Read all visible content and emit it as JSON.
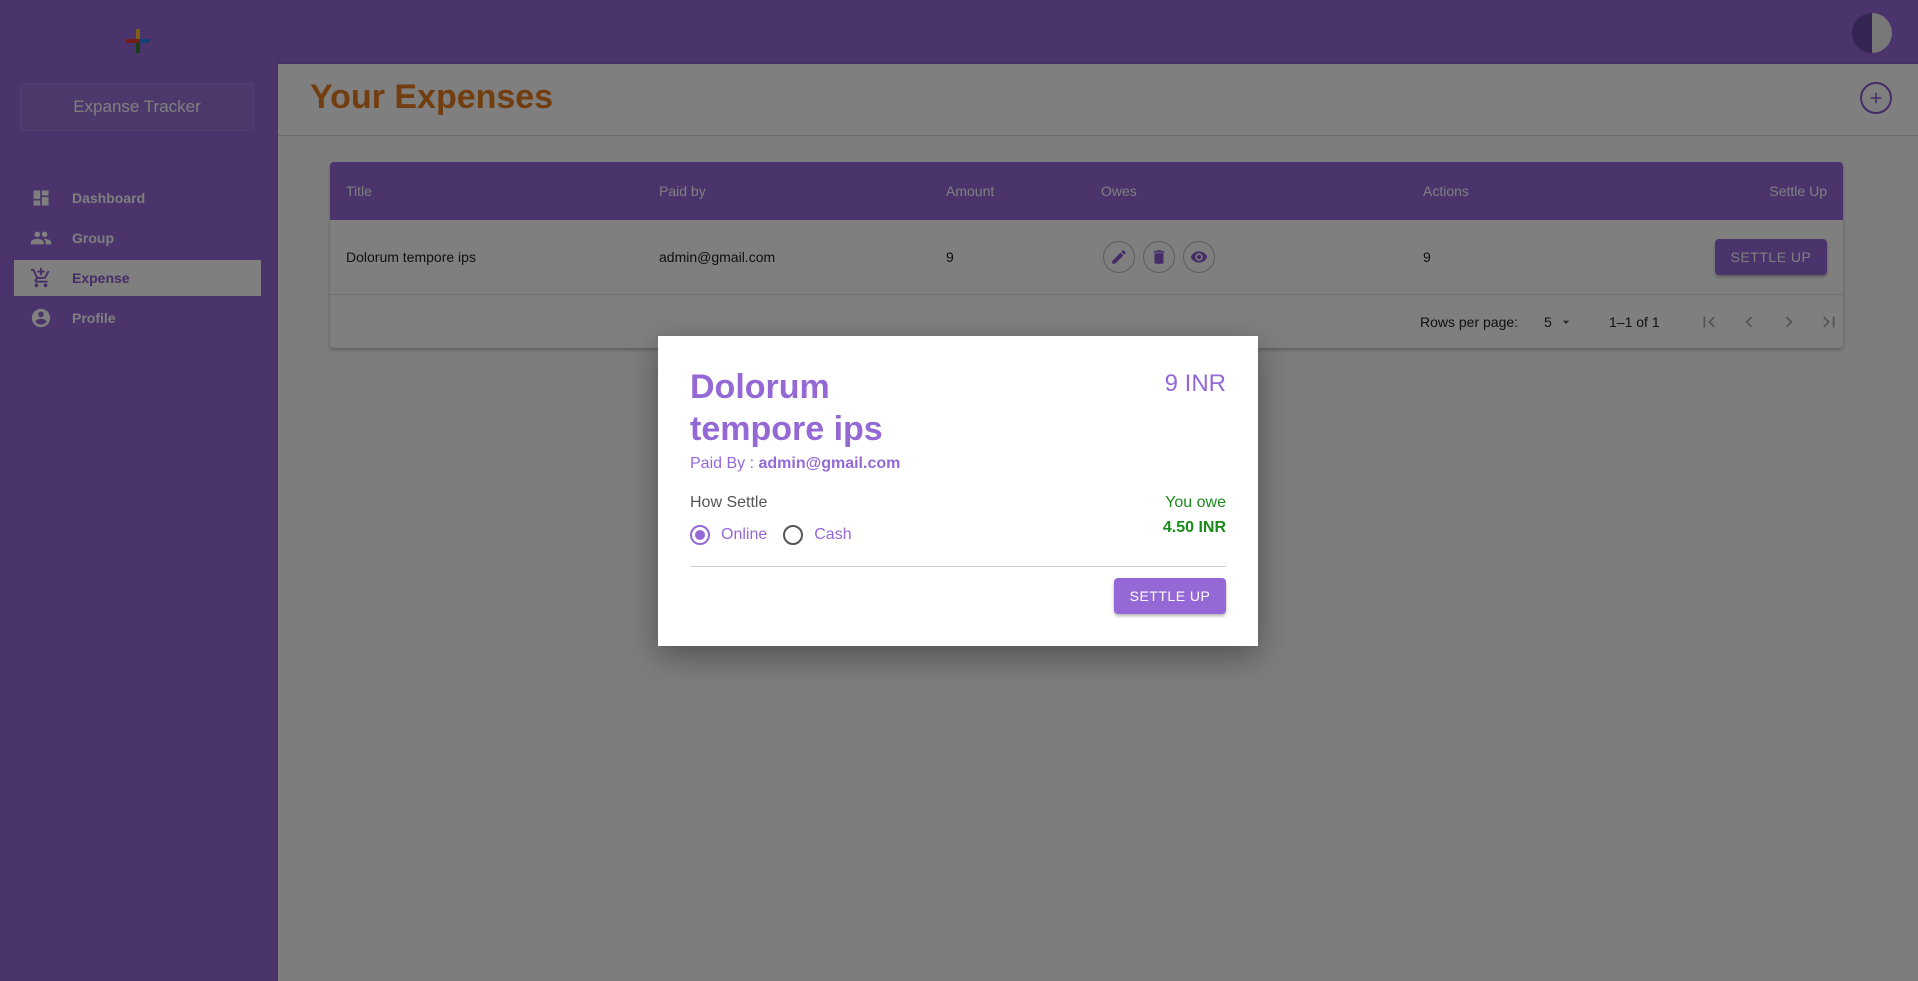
{
  "app": {
    "brand": "Expanse Tracker"
  },
  "sidebar": {
    "items": [
      {
        "label": "Dashboard",
        "icon": "dashboard-icon",
        "active": false
      },
      {
        "label": "Group",
        "icon": "group-icon",
        "active": false
      },
      {
        "label": "Expense",
        "icon": "cart-icon",
        "active": true
      },
      {
        "label": "Profile",
        "icon": "account-circle-icon",
        "active": false
      }
    ]
  },
  "header": {
    "page_title": "Your Expenses"
  },
  "table": {
    "columns": [
      "Title",
      "Paid by",
      "Amount",
      "Owes",
      "Actions",
      "Settle Up"
    ],
    "rows": [
      {
        "title": "Dolorum tempore ips",
        "paid_by": "admin@gmail.com",
        "amount": "9",
        "actions": "9",
        "settle_label": "SETTLE UP"
      }
    ],
    "pagination": {
      "rows_per_page_label": "Rows per page:",
      "rows_per_page": "5",
      "range": "1–1 of 1"
    }
  },
  "dialog": {
    "title": "Dolorum tempore ips",
    "amount": "9 INR",
    "paid_by_label": "Paid By : ",
    "paid_by": "admin@gmail.com",
    "how_settle_label": "How Settle",
    "options": [
      {
        "label": "Online",
        "checked": true
      },
      {
        "label": "Cash",
        "checked": false
      }
    ],
    "owe_label": "You owe",
    "owe_amount": "4.50 INR",
    "settle_label": "SETTLE UP"
  },
  "colors": {
    "primary": "#9469d6",
    "title_orange": "#e57b1e",
    "owe_green": "#1a8a1a"
  }
}
